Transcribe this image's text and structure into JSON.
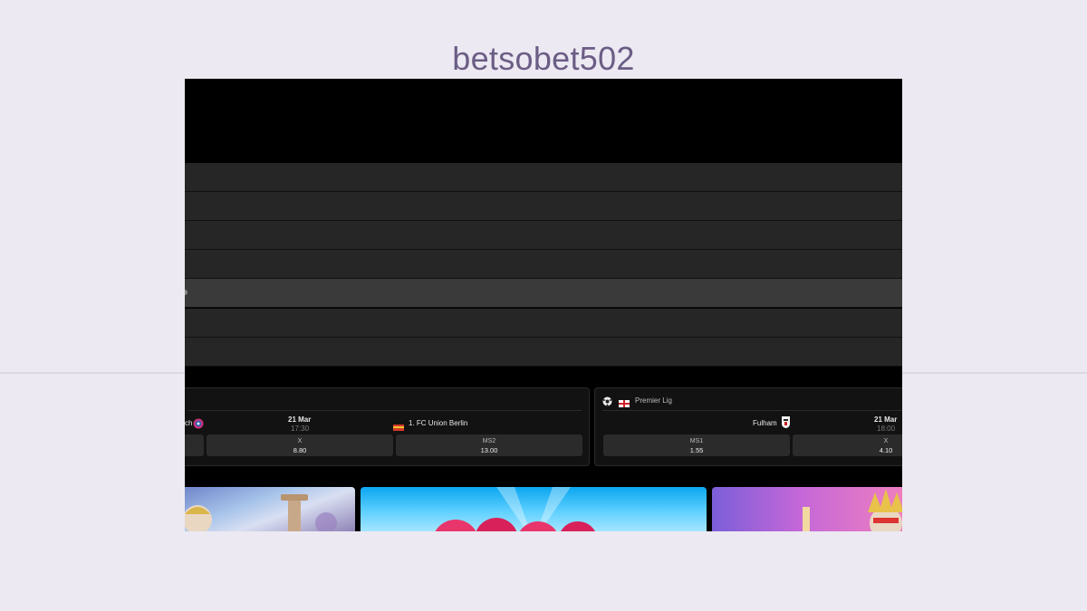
{
  "page": {
    "title": "betsobet502"
  },
  "matches": [
    {
      "home_team_partial": "ch",
      "date": "21 Mar",
      "time": "17:30",
      "away_team": "1. FC Union Berlin",
      "odds": [
        {
          "label": "X",
          "value": "8.80"
        },
        {
          "label": "MS2",
          "value": "13.00"
        }
      ]
    },
    {
      "league": "Premier Lig",
      "home_team": "Fulham",
      "date": "21 Mar",
      "time": "18:00",
      "odds": [
        {
          "label": "MS1",
          "value": "1.55"
        },
        {
          "label": "X",
          "value": "4.10"
        }
      ]
    }
  ],
  "icons": {
    "soccer": "soccer-ball-icon",
    "england_flag": "england-flag-icon",
    "bayern_logo": "bayern-logo-icon",
    "union_berlin_logo": "union-berlin-logo-icon",
    "fulham_logo": "fulham-logo-icon"
  },
  "colors": {
    "page_bg": "#ece9f2",
    "title": "#6b5d85",
    "menu_row": "#262626",
    "menu_row_active": "#3a3a3a"
  }
}
